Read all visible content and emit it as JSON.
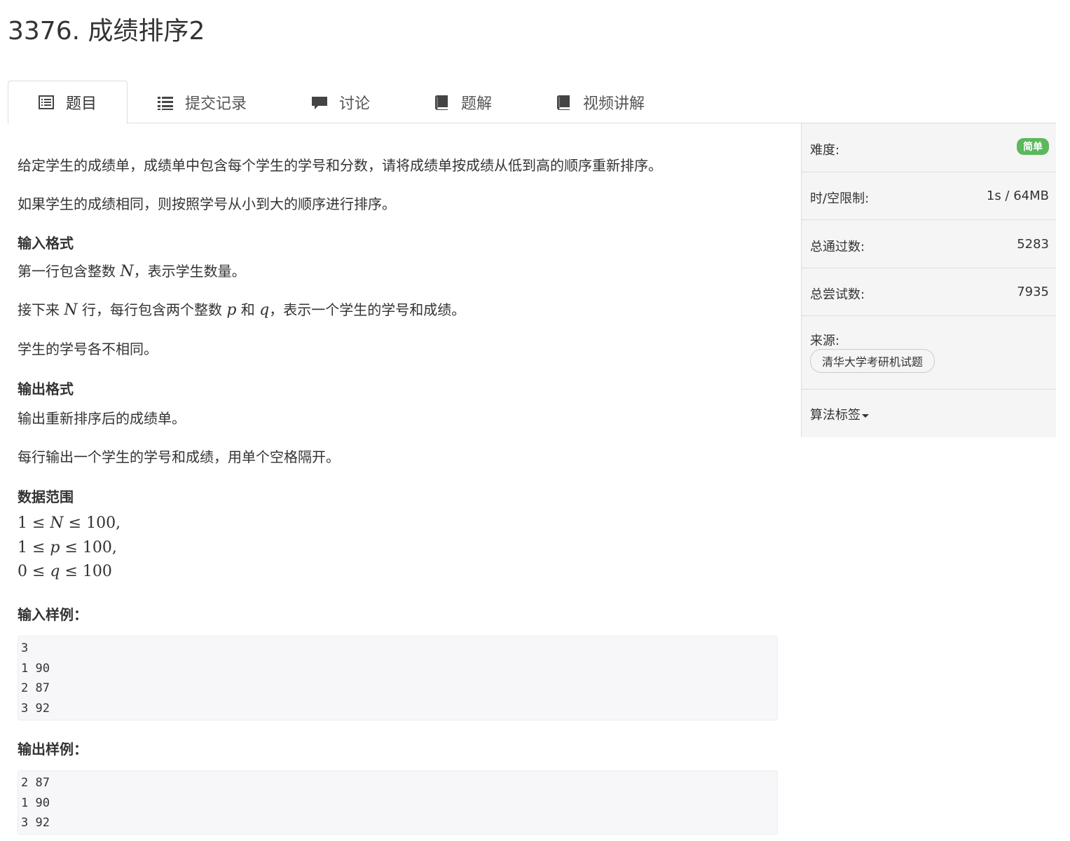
{
  "problem": {
    "title": "3376. 成绩排序2"
  },
  "tabs": [
    {
      "label": "题目",
      "icon": "list-alt-icon"
    },
    {
      "label": "提交记录",
      "icon": "list-icon"
    },
    {
      "label": "讨论",
      "icon": "comment-icon"
    },
    {
      "label": "题解",
      "icon": "book-icon"
    },
    {
      "label": "视频讲解",
      "icon": "book-icon"
    }
  ],
  "description": {
    "p1": "给定学生的成绩单，成绩单中包含每个学生的学号和分数，请将成绩单按成绩从低到高的顺序重新排序。",
    "p2": "如果学生的成绩相同，则按照学号从小到大的顺序进行排序。"
  },
  "input_format": {
    "heading": "输入格式",
    "l1_a": "第一行包含整数 ",
    "l1_var": "N",
    "l1_b": "，表示学生数量。",
    "l2_a": "接下来 ",
    "l2_var1": "N",
    "l2_b": " 行，每行包含两个整数 ",
    "l2_var2": "p",
    "l2_c": " 和 ",
    "l2_var3": "q",
    "l2_d": "，表示一个学生的学号和成绩。",
    "l3": "学生的学号各不相同。"
  },
  "output_format": {
    "heading": "输出格式",
    "l1": "输出重新排序后的成绩单。",
    "l2": "每行输出一个学生的学号和成绩，用单个空格隔开。"
  },
  "range": {
    "heading": "数据范围",
    "r1_a": "1 ≤ ",
    "r1_var": "N",
    "r1_b": " ≤ 100,",
    "r2_a": "1 ≤ ",
    "r2_var": "p",
    "r2_b": " ≤ 100,",
    "r3_a": "0 ≤ ",
    "r3_var": "q",
    "r3_b": " ≤ 100"
  },
  "sample_input": {
    "heading": "输入样例：",
    "code": "3\n1 90\n2 87\n3 92"
  },
  "sample_output": {
    "heading": "输出样例：",
    "code": "2 87\n1 90\n3 92"
  },
  "sidebar": {
    "difficulty_label": "难度:",
    "difficulty_badge": "简单",
    "difficulty_color": "#5cb85c",
    "limits_label": "时/空限制:",
    "limits_value": "1s / 64MB",
    "passed_label": "总通过数:",
    "passed_value": "5283",
    "tried_label": "总尝试数:",
    "tried_value": "7935",
    "source_label": "来源:",
    "source_tag": "清华大学考研机试题",
    "tags_label": "算法标签"
  }
}
